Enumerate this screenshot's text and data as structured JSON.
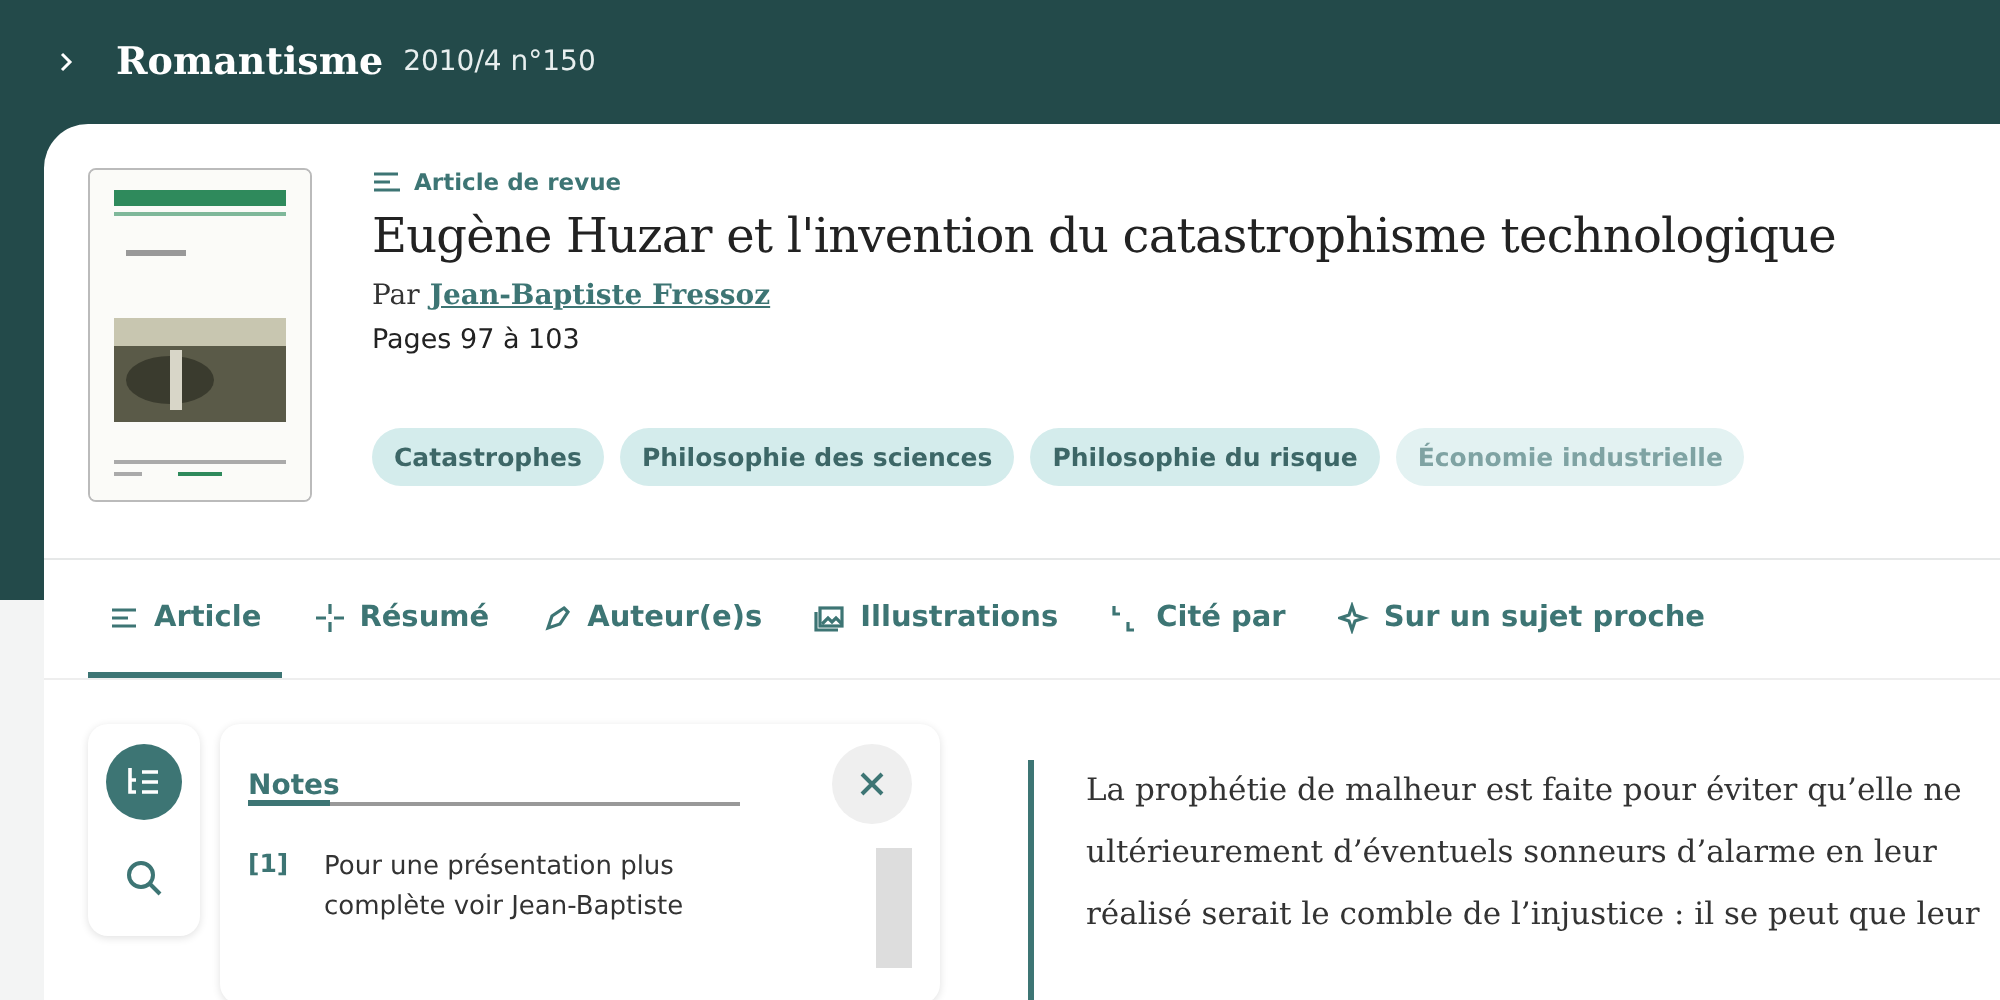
{
  "header": {
    "journal": "Romantisme",
    "issue": "2010/4 n°150"
  },
  "article": {
    "type": "Article de revue",
    "title": "Eugène Huzar et l'invention du catastrophisme technologique",
    "by": "Par",
    "author": "Jean-Baptiste Fressoz",
    "pages": "Pages 97 à 103"
  },
  "cover": {
    "kind": "picture"
  },
  "tags": [
    {
      "label": "Catastrophes",
      "faded": false
    },
    {
      "label": "Philosophie des sciences",
      "faded": false
    },
    {
      "label": "Philosophie du risque",
      "faded": false
    },
    {
      "label": "Économie industrielle",
      "faded": true
    }
  ],
  "tabs": [
    {
      "label": "Article",
      "kind": "article",
      "selected": true
    },
    {
      "label": "Résumé",
      "kind": "summary",
      "selected": false
    },
    {
      "label": "Auteur(e)s",
      "kind": "authors",
      "selected": false
    },
    {
      "label": "Illustrations",
      "kind": "images",
      "selected": false
    },
    {
      "label": "Cité par",
      "kind": "cited",
      "selected": false
    },
    {
      "label": "Sur un sujet proche",
      "kind": "related",
      "selected": false
    }
  ],
  "tools": [
    {
      "kind": "toc",
      "selected": true
    },
    {
      "kind": "search",
      "selected": false
    }
  ],
  "notes": {
    "title": "Notes",
    "items": [
      {
        "number": "[1]",
        "text": "Pour une présentation plus complète voir Jean-Baptiste"
      }
    ]
  },
  "quote": [
    "La prophétie de malheur est faite pour éviter qu’elle ne",
    "ultérieurement d’éventuels sonneurs d’alarme en leur",
    "réalisé serait le comble de l’injustice : il se peut que leur"
  ]
}
